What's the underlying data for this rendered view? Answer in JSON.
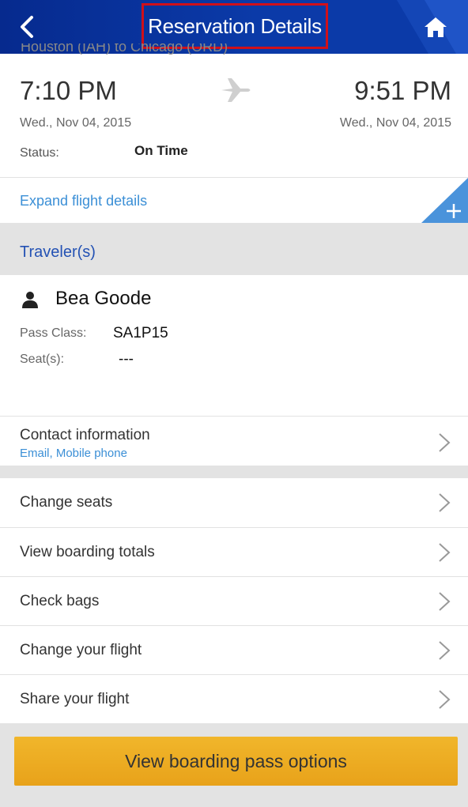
{
  "header": {
    "title": "Reservation Details"
  },
  "flight": {
    "route": "Houston (IAH) to Chicago (ORD)",
    "departure_time": "7:10 PM",
    "arrival_time": "9:51 PM",
    "departure_date": "Wed., Nov 04, 2015",
    "arrival_date": "Wed., Nov 04, 2015",
    "status_label": "Status:",
    "status_value": "On Time",
    "expand_label": "Expand flight details"
  },
  "travelers": {
    "section_title": "Traveler(s)",
    "name": "Bea Goode",
    "pass_class_label": "Pass Class:",
    "pass_class_value": "SA1P15",
    "seats_label": "Seat(s):",
    "seats_value": "---"
  },
  "contact": {
    "label": "Contact information",
    "sub": "Email, Mobile phone"
  },
  "menu": [
    {
      "label": "Change seats"
    },
    {
      "label": "View boarding totals"
    },
    {
      "label": "Check bags"
    },
    {
      "label": "Change your flight"
    },
    {
      "label": "Share your flight"
    }
  ],
  "cta": {
    "label": "View boarding pass options"
  },
  "colors": {
    "header": "#0b3aa8",
    "highlight_border": "#d0101a",
    "link": "#3b8fd6",
    "section_title": "#2452b4",
    "button": "#e8a21a"
  },
  "icons": {
    "back": "chevron-left-icon",
    "home": "home-icon",
    "plane": "airplane-icon",
    "person": "person-icon",
    "expand": "plus-icon",
    "row": "chevron-right-icon"
  }
}
